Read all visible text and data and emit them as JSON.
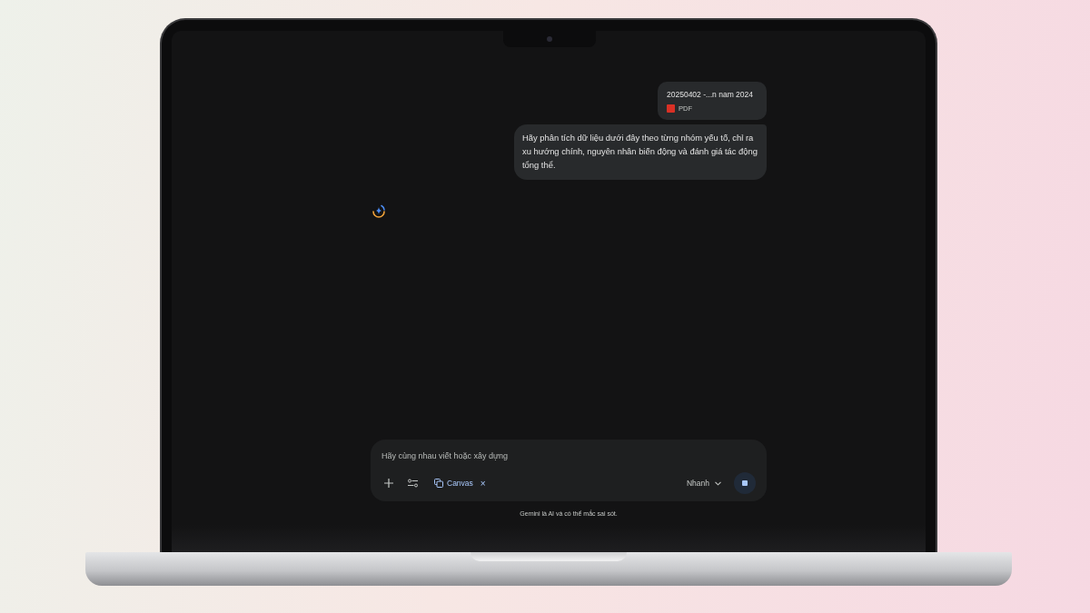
{
  "attachment": {
    "name": "20250402 -...n nam 2024",
    "type": "PDF"
  },
  "prompt": "Hãy phân tích dữ liệu dưới đây theo từng nhóm yếu tố, chỉ ra xu hướng chính, nguyên nhân biến động và đánh giá tác động tổng thể.",
  "input": {
    "placeholder": "Hãy cùng nhau viết hoặc xây dựng"
  },
  "tool_chip": {
    "label": "Canvas",
    "remove_mark": "×"
  },
  "mode": {
    "label": "Nhanh"
  },
  "disclaimer": "Gemini là AI và có thể mắc sai sót."
}
